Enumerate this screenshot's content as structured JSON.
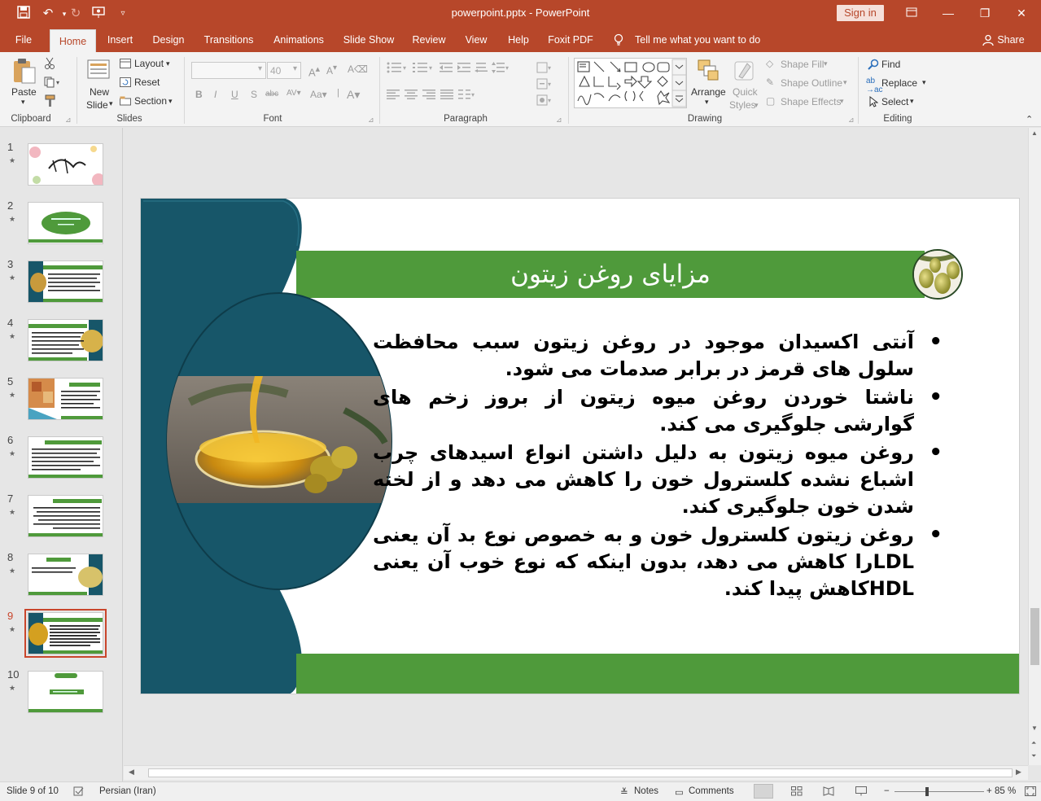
{
  "window": {
    "title": "powerpoint.pptx  -  PowerPoint",
    "sign_in": "Sign in"
  },
  "tabs": [
    "File",
    "Home",
    "Insert",
    "Design",
    "Transitions",
    "Animations",
    "Slide Show",
    "Review",
    "View",
    "Help",
    "Foxit PDF"
  ],
  "active_tab": "Home",
  "tell_me": "Tell me what you want to do",
  "share": "Share",
  "ribbon": {
    "clipboard": {
      "label": "Clipboard",
      "paste": "Paste"
    },
    "slides": {
      "label": "Slides",
      "new_slide_1": "New",
      "new_slide_2": "Slide",
      "layout": "Layout",
      "reset": "Reset",
      "section": "Section"
    },
    "font": {
      "label": "Font",
      "size": "40"
    },
    "paragraph": {
      "label": "Paragraph"
    },
    "drawing": {
      "label": "Drawing",
      "arrange": "Arrange",
      "quick_styles_1": "Quick",
      "quick_styles_2": "Styles",
      "shape_fill": "Shape Fill",
      "shape_outline": "Shape Outline",
      "shape_effects": "Shape Effects"
    },
    "editing": {
      "label": "Editing",
      "find": "Find",
      "replace": "Replace",
      "select": "Select"
    }
  },
  "thumbnails": [
    {
      "num": "1"
    },
    {
      "num": "2"
    },
    {
      "num": "3"
    },
    {
      "num": "4"
    },
    {
      "num": "5"
    },
    {
      "num": "6"
    },
    {
      "num": "7"
    },
    {
      "num": "8"
    },
    {
      "num": "9"
    },
    {
      "num": "10"
    }
  ],
  "selected_slide": "9",
  "slide": {
    "title": "مزایای روغن زیتون",
    "bullets": [
      "آنتی اکسیدان موجود در روغن زیتون سبب محافظت سلول های قرمز در برابر صدمات می شود.",
      "ناشتا خوردن روغن میوه زیتون از بروز زخم های گوارشی جلوگیری می کند.",
      "روغن میوه زیتون به دلیل داشتن انواع اسیدهای چرب اشباع نشده کلسترول خون را کاهش می دهد و از لخته شدن خون جلوگیری کند.",
      "روغن زیتون کلسترول خون و به خصوص نوع بد آن یعنی LDLرا کاهش می دهد، بدون اینکه که نوع خوب آن یعنی HDLکاهش پیدا کند."
    ]
  },
  "status": {
    "slide_of": "Slide 9 of 10",
    "language": "Persian (Iran)",
    "notes": "Notes",
    "comments": "Comments",
    "zoom": "85 %"
  },
  "colors": {
    "accent": "#b7472a",
    "teal": "#175669",
    "green": "#4f9a3b"
  }
}
